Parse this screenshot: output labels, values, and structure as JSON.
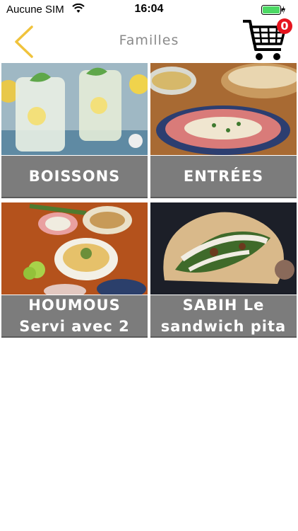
{
  "status": {
    "carrier": "Aucune SIM",
    "time": "16:04"
  },
  "nav": {
    "title": "Familles",
    "cart_count": "0"
  },
  "colors": {
    "accent": "#f0c33c",
    "badge": "#e6141e",
    "label_bg": "#7c7c7c",
    "battery": "#4cd964"
  },
  "families": [
    {
      "label": "BOISSONS"
    },
    {
      "label": "ENTRÉES"
    },
    {
      "label": "HOUMOUS\nServi avec 2"
    },
    {
      "label": "SABIH Le\nsandwich pita"
    }
  ]
}
